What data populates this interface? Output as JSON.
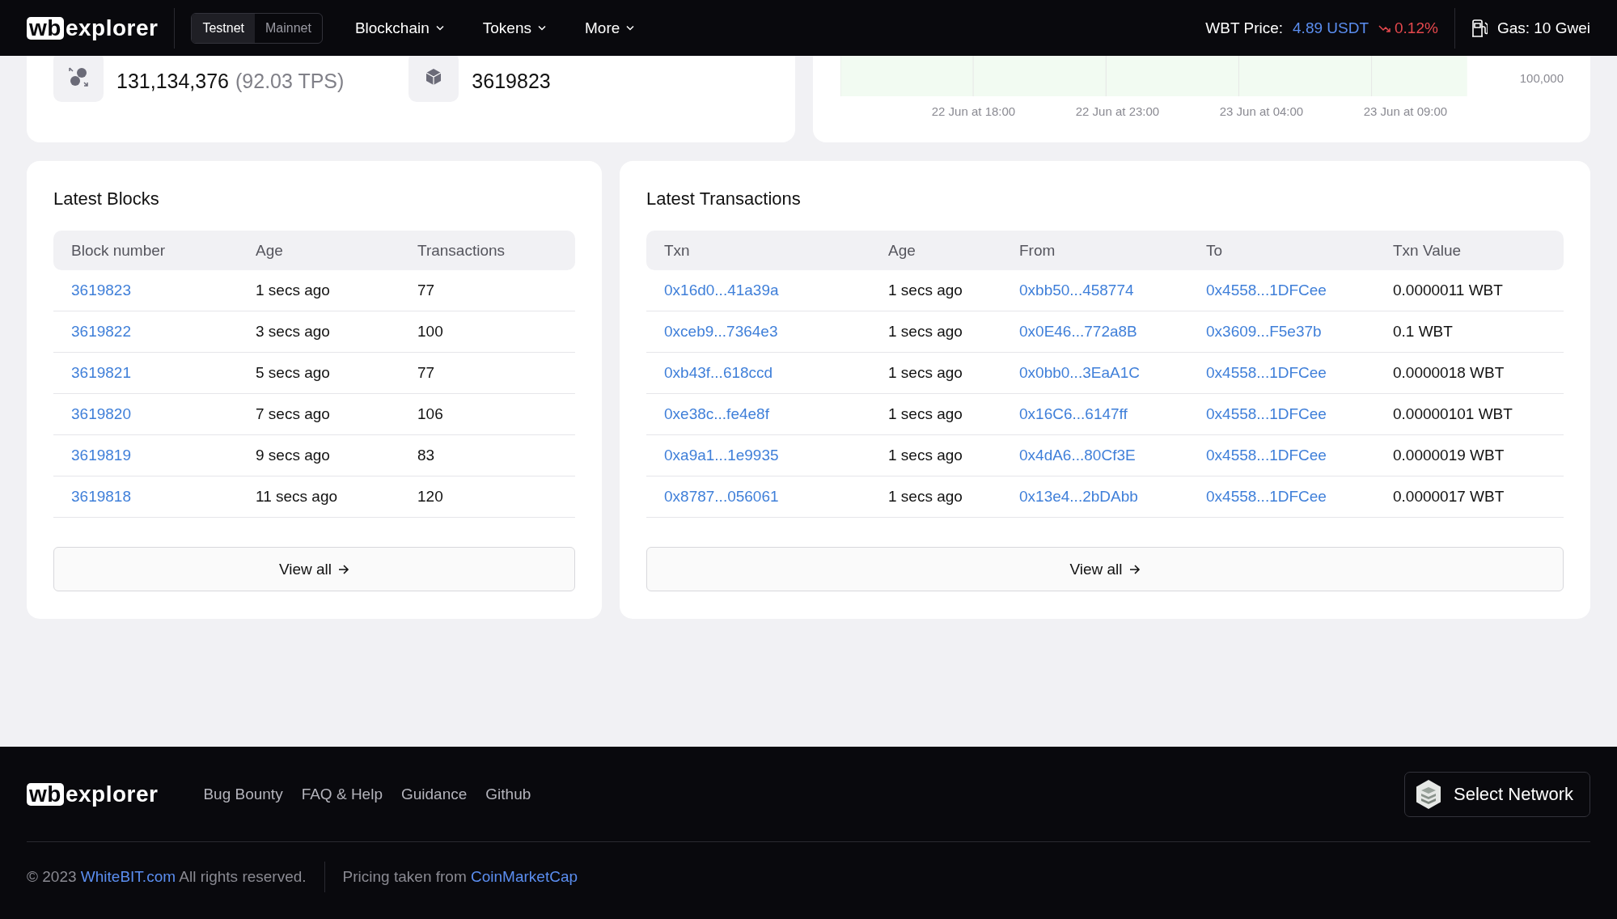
{
  "header": {
    "logo": {
      "mark": "wb",
      "text": "explorer"
    },
    "networks": [
      {
        "label": "Testnet",
        "selected": true
      },
      {
        "label": "Mainnet",
        "selected": false
      }
    ],
    "nav": [
      "Blockchain",
      "Tokens",
      "More"
    ],
    "price": {
      "label": "WBT Price:",
      "value": "4.89 USDT",
      "change": "0.12%",
      "falling": true
    },
    "gas": "Gas: 10 Gwei"
  },
  "stats": [
    {
      "value": "131,134,376",
      "note": "(92.03 TPS)",
      "kind": "transactions"
    },
    {
      "value": "3619823",
      "kind": "block"
    }
  ],
  "chart": {
    "y_tick": "100,000",
    "x_labels": [
      "22 Jun at 18:00",
      "22 Jun at 23:00",
      "23 Jun at 04:00",
      "23 Jun at 09:00"
    ]
  },
  "latest_blocks": {
    "title": "Latest Blocks",
    "columns": [
      "Block number",
      "Age",
      "Transactions"
    ],
    "rows": [
      {
        "block": "3619823",
        "age": "1 secs ago",
        "transactions": "77"
      },
      {
        "block": "3619822",
        "age": "3 secs ago",
        "transactions": "100"
      },
      {
        "block": "3619821",
        "age": "5 secs ago",
        "transactions": "77"
      },
      {
        "block": "3619820",
        "age": "7 secs ago",
        "transactions": "106"
      },
      {
        "block": "3619819",
        "age": "9 secs ago",
        "transactions": "83"
      },
      {
        "block": "3619818",
        "age": "11 secs ago",
        "transactions": "120"
      }
    ],
    "button": "View all"
  },
  "latest_transactions": {
    "title": "Latest Transactions",
    "columns": [
      "Txn",
      "Age",
      "From",
      "To",
      "Txn Value"
    ],
    "rows": [
      {
        "txn": "0x16d0...41a39a",
        "age": "1 secs ago",
        "from": "0xbb50...458774",
        "to": "0x4558...1DFCee",
        "value": "0.0000011 WBT"
      },
      {
        "txn": "0xceb9...7364e3",
        "age": "1 secs ago",
        "from": "0x0E46...772a8B",
        "to": "0x3609...F5e37b",
        "value": "0.1 WBT"
      },
      {
        "txn": "0xb43f...618ccd",
        "age": "1 secs ago",
        "from": "0x0bb0...3EaA1C",
        "to": "0x4558...1DFCee",
        "value": "0.0000018 WBT"
      },
      {
        "txn": "0xe38c...fe4e8f",
        "age": "1 secs ago",
        "from": "0x16C6...6147ff",
        "to": "0x4558...1DFCee",
        "value": "0.00000101 WBT"
      },
      {
        "txn": "0xa9a1...1e9935",
        "age": "1 secs ago",
        "from": "0x4dA6...80Cf3E",
        "to": "0x4558...1DFCee",
        "value": "0.0000019 WBT"
      },
      {
        "txn": "0x8787...056061",
        "age": "1 secs ago",
        "from": "0x13e4...2bDAbb",
        "to": "0x4558...1DFCee",
        "value": "0.0000017 WBT"
      }
    ],
    "button": "View all"
  },
  "footer": {
    "logo": {
      "mark": "wb",
      "text": "explorer"
    },
    "links": [
      "Bug Bounty",
      "FAQ & Help",
      "Guidance",
      "Github"
    ],
    "network_button": "Select Network",
    "copyright": {
      "prefix": "© 2023",
      "link": "WhiteBIT.com",
      "suffix": "All rights reserved."
    },
    "pricing": {
      "prefix": "Pricing taken from",
      "link": "CoinMarketCap"
    }
  }
}
